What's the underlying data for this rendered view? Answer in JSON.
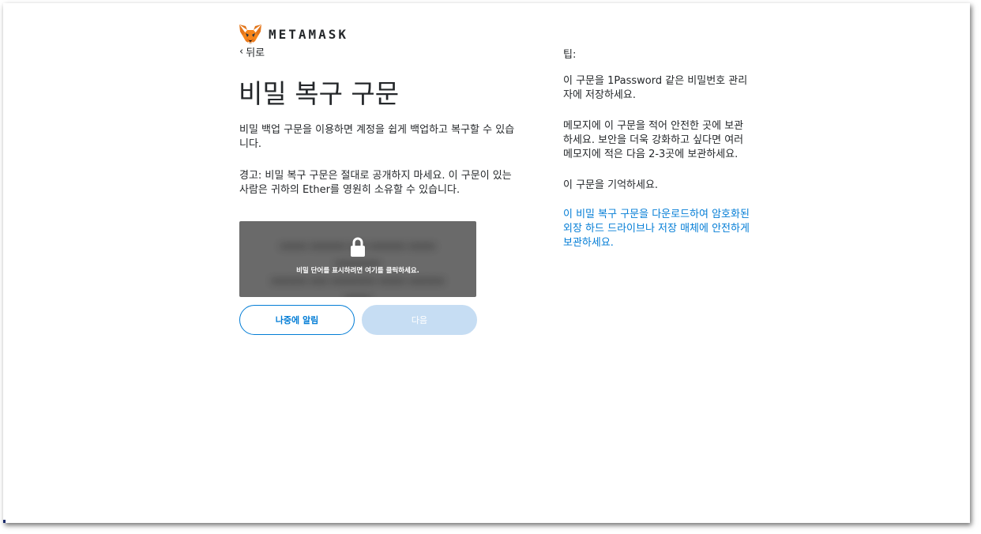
{
  "header": {
    "brand": "METAMASK",
    "back_label": "뒤로"
  },
  "main": {
    "title": "비밀 복구 구문",
    "intro": "비밀 백업 구문을 이용하면 계정을 쉽게 백업하고 복구할 수 있습니다.",
    "warning": "경고: 비밀 복구 구문은 절대로 공개하지 마세요. 이 구문이 있는 사람은 귀하의 Ether를 영원히 소유할 수 있습니다.",
    "reveal_text": "비밀 단어를 표시하려면 여기를 클릭하세요.",
    "remind_later_label": "나중에 알림",
    "next_label": "다음"
  },
  "tips": {
    "title": "팁:",
    "items": [
      "이 구문을 1Password 같은 비밀번호 관리자에 저장하세요.",
      "메모지에 이 구문을 적어 안전한 곳에 보관하세요. 보안을 더욱 강화하고 싶다면 여러 메모지에 적은 다음 2-3곳에 보관하세요.",
      "이 구문을 기억하세요."
    ],
    "download_link": "이 비밀 복구 구문을 다운로드하여 암호화된 외장 하드 드라이브나 저장 매체에 안전하게 보관하세요."
  },
  "icons": {
    "logo": "metamask-fox-icon",
    "back": "chevron-left-icon",
    "lock": "lock-icon"
  },
  "colors": {
    "accent": "#037dd6",
    "disabled_button": "#c6ddf3",
    "reveal_overlay": "#6a6a6a",
    "text": "#24272a"
  }
}
